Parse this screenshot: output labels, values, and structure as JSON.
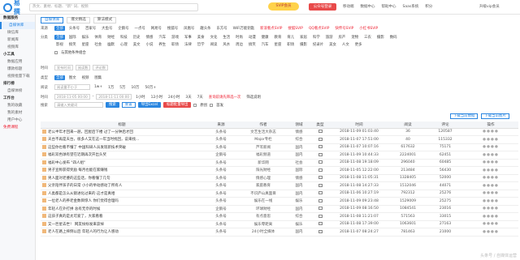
{
  "top": {
    "logo": "易撰",
    "search_placeholder": "热文、素材、标题、\"新\" 词、视频",
    "promo": "SVIP会员",
    "wx_btn": "公众号登录",
    "nav": [
      "移动端",
      "数据中心",
      "帮助中心",
      "Saas系统",
      "积分"
    ],
    "user": "升级vip会员"
  },
  "sidebar": [
    "数据服务",
    "自媒体库",
    "微信库",
    "新闻库",
    "视频库",
    "小工具",
    "数据应用",
    "爆款标题",
    "视频批量下载",
    "排行榜",
    "自媒体榜",
    "工作台",
    "我的收藏",
    "我的素材",
    "用户中心",
    "免费课程"
  ],
  "tabs": [
    "自媒体库",
    "爆文精选",
    "算法模式"
  ],
  "filters": {
    "r1_label": "来源",
    "r1": [
      "全部",
      "头条号",
      "百家号",
      "大鱼号",
      "企鹅号",
      "一点号",
      "网易号",
      "搜狐号",
      "凤凰号",
      "趣头条",
      "东方号",
      "WiFi万能钥匙",
      "新浪看点SVIP",
      "搜狐SVIP",
      "QQ看点SVIP",
      "快传号SVIP",
      "小红书SVIP"
    ],
    "r2_label": "分类",
    "r2": [
      "全部",
      "国际",
      "娱乐",
      "体育",
      "财经",
      "科技",
      "历史",
      "情感",
      "汽车",
      "游戏",
      "军事",
      "美食",
      "文化",
      "生活",
      "时尚",
      "动漫",
      "健康",
      "教育",
      "育儿",
      "家居",
      "科学",
      "旅游",
      "房产",
      "宠物",
      "三农",
      "摄影",
      "数码"
    ],
    "r3": [
      "影视",
      "搞笑",
      "星座",
      "社会",
      "幽默",
      "心理",
      "美文",
      "小说",
      "养生",
      "职场",
      "法律",
      "哲学",
      "阅读",
      "风水",
      "周边",
      "搞笑",
      "汽车",
      "星座",
      "职场",
      "摄影",
      "纪录片",
      "美女",
      "人文",
      "更多"
    ],
    "r4": "与其他条件组合",
    "r5_label": "时间",
    "r5a": "发布时间",
    "r5b": "阅读数",
    "r5c": "评论数",
    "r6_label": "类型",
    "r6": [
      "全部",
      "图文",
      "视频",
      "图集"
    ],
    "r7_label": "阅读",
    "r7_placeholder": "阅读量不小于",
    "r7": [
      "1w+",
      "1万",
      "5万",
      "10万",
      "50万+"
    ],
    "r8_label": "时间",
    "r8_from": "2018-11-05 00:00",
    "r8_to": "2018-11-11 00:00",
    "r8": [
      "1小时",
      "12小时",
      "24小时",
      "3天",
      "7天"
    ],
    "r8_note": "查询前请先筛选一次",
    "r8_extra": "筛选说明",
    "r9_label": "搜索",
    "r9_placeholder": "请输入关键词",
    "btn_search": "搜索",
    "btn_reset": "重置",
    "btn_export": "导出Excel",
    "btn_batch": "标题批量导出",
    "chk1": "原创",
    "chk2": "首发"
  },
  "exports": [
    "下载当前数据",
    "下载当前图片"
  ],
  "table": {
    "headers": [
      "标题",
      "来源",
      "作者",
      "领域",
      "类型",
      "时间",
      "阅读",
      "评论",
      "操作"
    ],
    "rows": [
      [
        "老公半年才回来一趟，回屋后下楼 过了一分钟后才回",
        "头条号",
        "文艺生活大杂志",
        "情感",
        "",
        "2018-11-09 01:03:40",
        "36",
        "120587"
      ],
      [
        "天台不再是天台，很多人又在这一年当时找回，说来找...",
        "头条号",
        "Major专栏",
        "综合",
        "",
        "2018-11-07 17:51:00",
        "40",
        "115332"
      ],
      [
        "这些你也看不懂了 中国科研人员发现新技术突破",
        "头条号",
        "芦苇新闻",
        "国内",
        "",
        "2018-11-07 10:07:16",
        "617632",
        "75171"
      ],
      [
        "福彩双色球有望在近期再次开出头奖",
        "企鹅号",
        "福彩频道",
        "国内",
        "",
        "2018-11-09 10:44:33",
        "2224001",
        "62451"
      ],
      [
        "福彩中心发布 \"四人组\"",
        "头条号",
        "新华网",
        "社会",
        "",
        "2018-11-08 19:18:09",
        "296040",
        "60485"
      ],
      [
        "男子宣称获得奖励 每月也能在家赚钱",
        "头条号",
        "阳光财经",
        "国际",
        "",
        "2018-11-05 12:22:00",
        "213484",
        "56430"
      ],
      [
        "男人面对老婆的这些话，你看懂了几句",
        "头条号",
        "情感心理",
        "情感",
        "",
        "2018-11-08 11:05:31",
        "1328405",
        "52000"
      ],
      [
        "父亲陪伴孩子的日常 小小的举动感动了所有人",
        "头条号",
        "家庭教育",
        "国内",
        "",
        "2018-11-08 14:27:33",
        "1512046",
        "44071"
      ],
      [
        "人类都是怎么从猿进化过来的 这才是真相",
        "头条号",
        "不识庐山真面目",
        "国内",
        "",
        "2018-11-06 10:27:19",
        "792312",
        "25276"
      ],
      [
        "一位老人的养老金数目惊人 你们觉得合理吗",
        "头条号",
        "娱乐在一线",
        "娱乐",
        "",
        "2018-11-09 09:23:48",
        "1529009",
        "25275"
      ],
      [
        "年轻人在外打拼 总有无奈的时候",
        "企鹅号",
        "环球财经",
        "国内",
        "",
        "2018-11-09 08:16:50",
        "1084541",
        "23016"
      ],
      [
        "这孩子真的是太可爱了，大家看看",
        "头条号",
        "有点意思",
        "综合",
        "",
        "2018-11-08 11:21:07",
        "571563",
        "33015"
      ],
      [
        "又一巨星去世！ 网友纷纷发来哀悼",
        "头条号",
        "娱乐零距离",
        "娱乐",
        "",
        "2018-11-08 17:39:00",
        "1063601",
        "27163"
      ],
      [
        "老人在路上摔倒以后 年轻人的行为让人感动",
        "头条号",
        "24小时全媒体",
        "国内",
        "",
        "2018-11-07 08:24:27",
        "781463",
        "21000"
      ]
    ]
  },
  "watermark": "头条号 / 自媒体运营"
}
